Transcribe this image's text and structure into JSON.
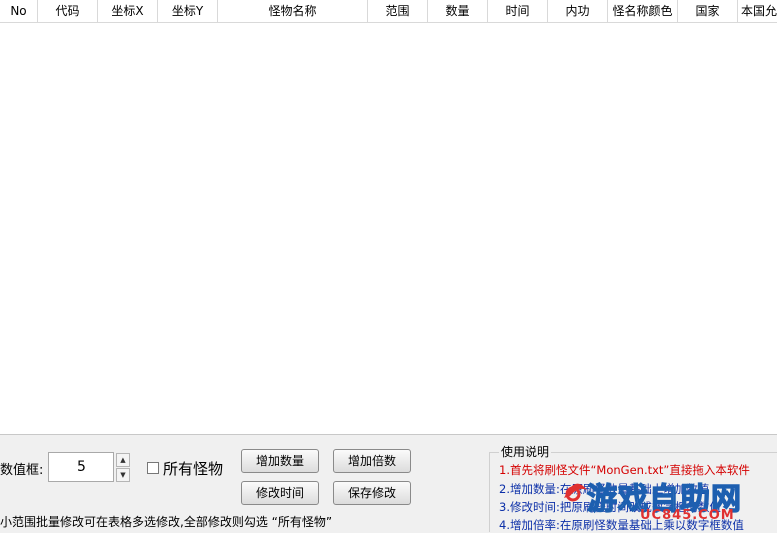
{
  "table": {
    "columns": [
      {
        "label": "No"
      },
      {
        "label": "代码"
      },
      {
        "label": "坐标X"
      },
      {
        "label": "坐标Y"
      },
      {
        "label": "怪物名称"
      },
      {
        "label": "范围"
      },
      {
        "label": "数量"
      },
      {
        "label": "时间"
      },
      {
        "label": "内功"
      },
      {
        "label": "怪名称颜色"
      },
      {
        "label": "国家"
      },
      {
        "label": "本国允"
      }
    ],
    "rows": []
  },
  "controls": {
    "value_label": "数值框:",
    "value": "5",
    "all_monsters_label": "所有怪物",
    "add_count_label": "增加数量",
    "add_multiplier_label": "增加倍数",
    "modify_time_label": "修改时间",
    "save_label": "保存修改",
    "hint": "小范围批量修改可在表格多选修改,全部修改则勾选 “所有怪物”"
  },
  "help": {
    "title": "使用说明",
    "lines": [
      {
        "text": "1.首先将刷怪文件“MonGen.txt”直接拖入本软件",
        "color": "#d40000"
      },
      {
        "text": "2.增加数量:在原刷怪数量基础上增加数值",
        "color": "#0b2fa8"
      },
      {
        "text": "3.修改时间:把原刷怪时间改成数字框的数值",
        "color": "#0b2fa8"
      },
      {
        "text": "4.增加倍率:在原刷怪数量基础上乘以数字框数值",
        "color": "#0b2fa8"
      }
    ]
  },
  "watermark": {
    "text": "游戏自助网",
    "url": "UC845.COM"
  },
  "colors": {
    "help_red": "#d40000",
    "help_blue": "#0b2fa8",
    "watermark_blue": "#1d5fb0",
    "watermark_red": "#e03030"
  }
}
